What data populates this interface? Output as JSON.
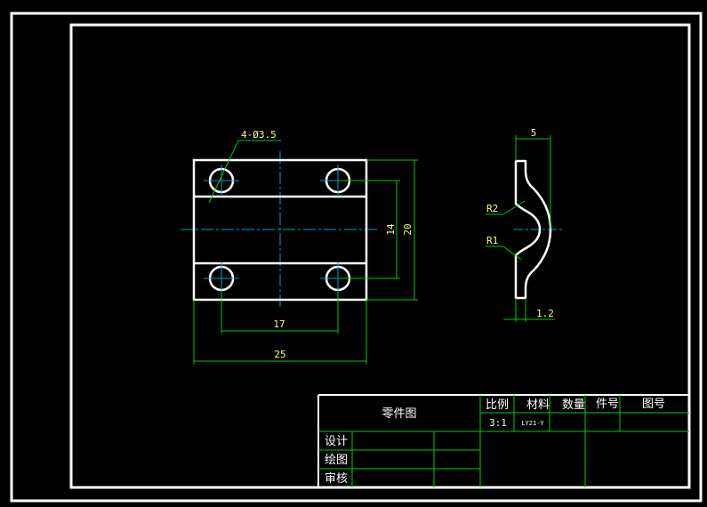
{
  "colors": {
    "background": "#000000",
    "outline": "#ffffff",
    "dimension": "#00cc00",
    "centerline": "#00a0c8",
    "annotation_text": "#ffff66",
    "table_text": "#ffffff"
  },
  "drawing": {
    "front_view": {
      "hole_callout": "4-Ø3.5",
      "dim_height_inner": "14",
      "dim_height_outer": "20",
      "dim_width_inner": "17",
      "dim_width_outer": "25"
    },
    "side_view": {
      "dim_top": "5",
      "radius_outer": "R2",
      "radius_inner": "R1",
      "thickness": "1.2"
    }
  },
  "title_block": {
    "part_name": "零件图",
    "headers": {
      "scale": "比例",
      "material": "材料",
      "quantity": "数量",
      "part_no": "件号",
      "drawing_no": "图号"
    },
    "values": {
      "scale": "3:1",
      "material": "LY21-Y"
    },
    "roles": {
      "design": "设计",
      "draft": "绘图",
      "review": "审核"
    }
  }
}
